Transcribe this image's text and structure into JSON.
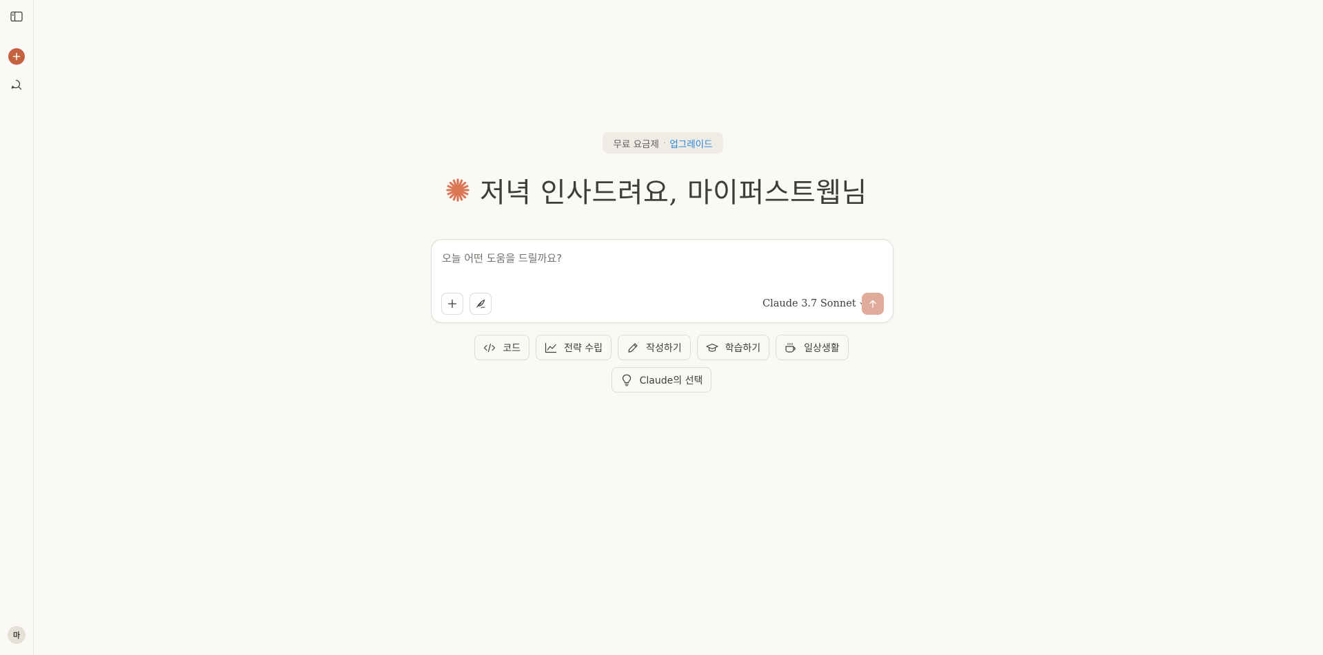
{
  "sidebar": {
    "toggle_icon": "sidebar-toggle-icon",
    "new_chat_icon": "plus-icon",
    "search_icon": "chat-search-icon",
    "avatar_initial": "마"
  },
  "plan": {
    "label": "무료 요금제",
    "separator": "·",
    "upgrade": "업그레이드"
  },
  "greeting": {
    "text": "저녁 인사드려요, 마이퍼스트웹님",
    "icon": "claude-spark-icon"
  },
  "composer": {
    "placeholder": "오늘 어떤 도움을 드릴까요?",
    "value": "",
    "model": "Claude 3.7 Sonnet",
    "send_icon": "arrow-up-icon"
  },
  "chips": [
    {
      "label": "코드",
      "icon": "code-icon"
    },
    {
      "label": "전략 수립",
      "icon": "chart-line-icon"
    },
    {
      "label": "작성하기",
      "icon": "pencil-icon"
    },
    {
      "label": "학습하기",
      "icon": "graduation-cap-icon"
    },
    {
      "label": "일상생활",
      "icon": "coffee-cup-icon"
    },
    {
      "label": "Claude의 선택",
      "icon": "lightbulb-icon"
    }
  ],
  "colors": {
    "background": "#faf9f5",
    "accent": "#c6613f",
    "send_disabled": "#e0ab9a",
    "link": "#2c84db"
  }
}
